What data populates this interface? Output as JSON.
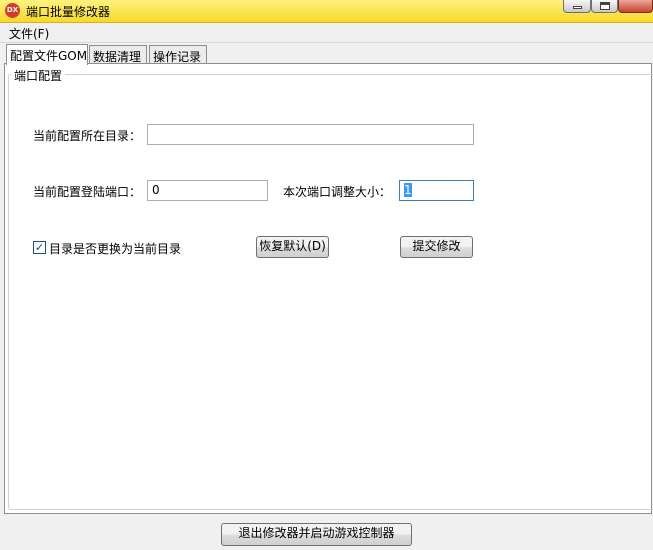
{
  "window": {
    "title": "端口批量修改器",
    "icon_text": "DX"
  },
  "menu": {
    "file": "文件(F)"
  },
  "tabs": [
    "配置文件GOM",
    "数据清理",
    "操作记录"
  ],
  "group": {
    "title": "端口配置"
  },
  "form": {
    "config_dir_label": "当前配置所在目录：",
    "config_dir_value": "",
    "login_port_label": "当前配置登陆端口：",
    "login_port_value": "0",
    "adjust_label": "本次端口调整大小：",
    "adjust_value": "1",
    "checkbox_label": "目录是否更换为当前目录",
    "checkbox_checked": true,
    "checkbox_mark": "✓",
    "restore_button": "恢复默认(D)",
    "submit_button": "提交修改"
  },
  "bottom": {
    "exit_button": "退出修改器并启动游戏控制器"
  }
}
